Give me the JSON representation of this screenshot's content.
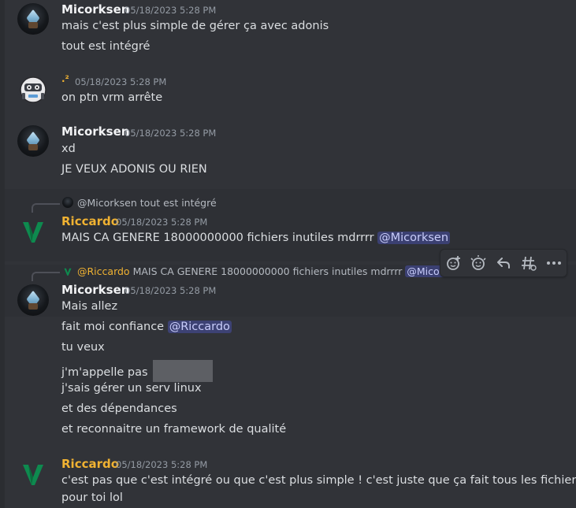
{
  "messages": [
    {
      "author": "Micorksen",
      "timestamp": "05/18/2023 5:28 PM",
      "lines": [
        "mais c'est plus simple de gérer ça avec adonis",
        "tout est intégré"
      ]
    },
    {
      "author": ".²",
      "timestamp": "05/18/2023 5:28 PM",
      "lines": [
        "on ptn vrm arrête"
      ]
    },
    {
      "author": "Micorksen",
      "timestamp": "05/18/2023 5:28 PM",
      "lines": [
        "xd",
        "JE VEUX ADONIS OU RIEN"
      ]
    },
    {
      "reply": {
        "author": "@Micorksen",
        "text": "tout est intégré"
      },
      "author": "Riccardo",
      "timestamp": "05/18/2023 5:28 PM",
      "lines": [
        "MAIS CA GENERE 18000000000 fichiers inutiles mdrrrr"
      ],
      "mention": "@Micorksen"
    },
    {
      "reply": {
        "author": "@Riccardo",
        "text": "MAIS CA GENERE 18000000000 fichiers inutiles mdrrrr",
        "mention": "@Micorksen"
      },
      "author": "Micorksen",
      "timestamp": "05/18/2023 5:28 PM",
      "lines": [
        "Mais allez",
        "fait moi confiance",
        "tu veux",
        "j'm'appelle pas",
        "j'sais gérer un serv linux",
        "et des dépendances",
        "et reconnaitre un framework de qualité"
      ],
      "mention": "@Riccardo"
    },
    {
      "author": "Riccardo",
      "timestamp": "05/18/2023 5:28 PM",
      "lines": [
        "c'est pas que c'est intégré ou que c'est plus simple ! c'est juste que ça fait tous les fichiers",
        "pour toi lol"
      ]
    }
  ],
  "toolbar": {
    "buttons": [
      "add-reaction-icon",
      "super-reaction-icon",
      "reply-icon",
      "create-thread-icon",
      "more-icon"
    ]
  },
  "colors": {
    "background": "#313338",
    "author_default": "#f2f3f5",
    "author_riccardo": "#f0b232",
    "mention_bg": "#3c4270",
    "timestamp": "#949ba4"
  }
}
